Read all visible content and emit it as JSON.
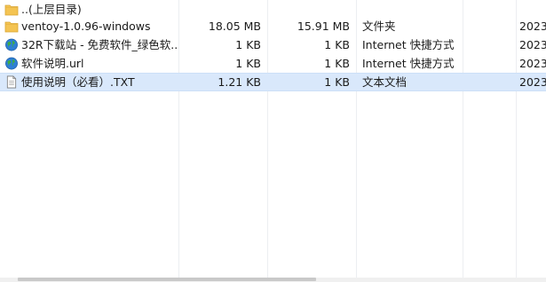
{
  "files": [
    {
      "name": "..(上层目录)",
      "size": "",
      "packed": "",
      "type": "",
      "date": "",
      "icon": "folder-up-icon"
    },
    {
      "name": "ventoy-1.0.96-windows",
      "size": "18.05 MB",
      "packed": "15.91 MB",
      "type": "文件夹",
      "date": "2023",
      "icon": "folder-icon"
    },
    {
      "name": "32R下载站 - 免费软件_绿色软...",
      "size": "1 KB",
      "packed": "1 KB",
      "type": "Internet 快捷方式",
      "date": "2023",
      "icon": "internet-shortcut-icon"
    },
    {
      "name": "软件说明.url",
      "size": "1 KB",
      "packed": "1 KB",
      "type": "Internet 快捷方式",
      "date": "2023",
      "icon": "internet-shortcut-icon"
    },
    {
      "name": "使用说明（必看）.TXT",
      "size": "1.21 KB",
      "packed": "1 KB",
      "type": "文本文档",
      "date": "2023",
      "icon": "text-file-icon"
    }
  ],
  "selected_index": 4,
  "colors": {
    "selection": "#d9e8fb",
    "folder": "#f4c453"
  }
}
